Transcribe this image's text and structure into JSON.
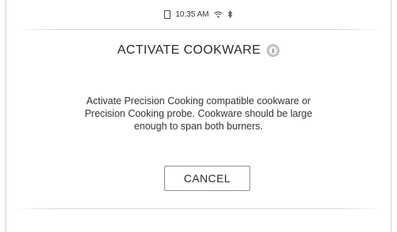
{
  "status_bar": {
    "time": "10:35 AM",
    "icons": [
      "phone-icon",
      "wifi-icon",
      "bluetooth-icon"
    ]
  },
  "dialog": {
    "title": "ACTIVATE COOKWARE",
    "title_icon": "info-icon",
    "message_lines": [
      "Activate Precision Cooking compatible cookware or",
      "Precision Cooking probe.  Cookware should be large",
      "enough to span both burners."
    ],
    "cancel_label": "CANCEL"
  },
  "colors": {
    "background": "#ffffff",
    "text": "#2b2b2b",
    "divider": "#d6d6d6",
    "button_border": "#8f8f8f",
    "icon_gray": "#c9c9c9"
  }
}
